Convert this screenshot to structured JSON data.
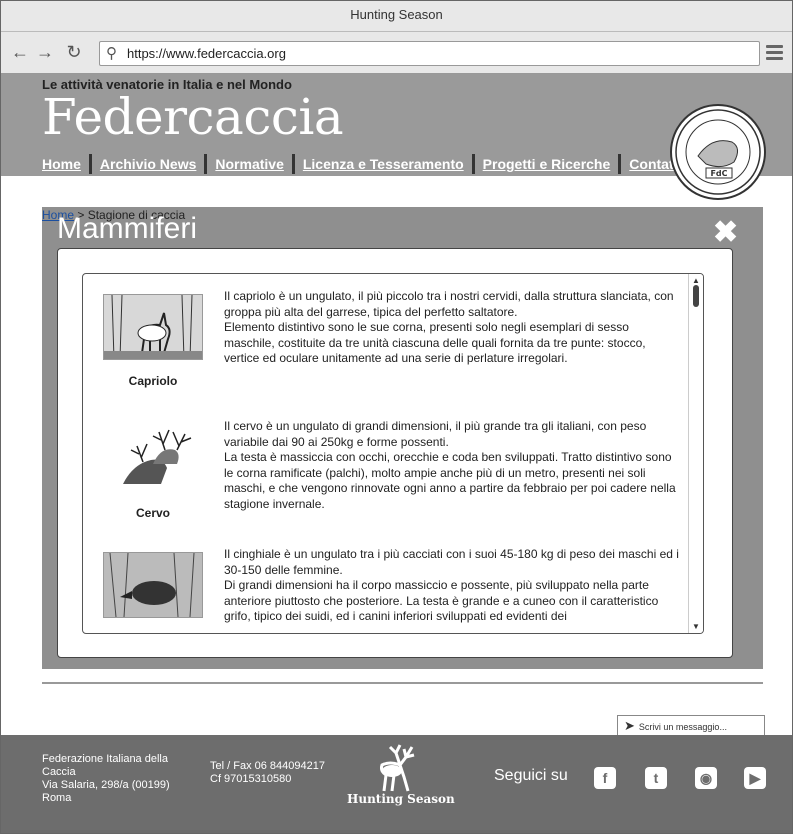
{
  "window": {
    "title": "Hunting Season"
  },
  "browser": {
    "url": "https://www.federcaccia.org"
  },
  "site": {
    "tagline": "Le attività venatorie in Italia e nel Mondo",
    "brand": "Federcaccia",
    "nav": [
      "Home",
      "Archivio News",
      "Normative",
      "Licenza e Tesseramento",
      "Progetti e Ricerche",
      "Contatti"
    ]
  },
  "breadcrumb": {
    "home": "Home",
    "sep": ">",
    "current": "Stagione di caccia"
  },
  "modal": {
    "title": "Mammiferi",
    "close": "✖",
    "entries": [
      {
        "name": "Capriolo",
        "text": "Il capriolo è un ungulato, il più piccolo tra i nostri cervidi, dalla struttura slanciata, con groppa più alta del garrese, tipica del perfetto saltatore.\nElemento distintivo sono le sue corna, presenti solo negli esemplari di sesso maschile, costituite da tre unità ciascuna delle quali fornita da tre punte: stocco, vertice ed oculare unitamente ad una serie di perlature irregolari."
      },
      {
        "name": "Cervo",
        "text": "Il cervo è un ungulato di grandi dimensioni, il più grande tra gli italiani, con peso variabile dai 90 ai 250kg e forme possenti.\nLa testa è massiccia con occhi, orecchie e coda ben sviluppati. Tratto distintivo sono le corna ramificate (palchi), molto ampie anche più di un metro, presenti nei soli maschi, e che vengono rinnovate ogni anno a partire da febbraio per poi cadere nella stagione invernale."
      },
      {
        "name": "",
        "text": "Il cinghiale è un ungulato tra i più cacciati con i suoi 45-180 kg di peso dei maschi ed i 30-150 delle femmine.\nDi grandi dimensioni ha il corpo massiccio e possente, più sviluppato nella parte anteriore piuttosto che posteriore. La testa è grande e a cuneo con il caratteristico grifo, tipico dei suidi, ed i canini inferiori sviluppati ed evidenti dei"
      }
    ]
  },
  "chat": {
    "placeholder": "Scrivi un messaggio..."
  },
  "footer": {
    "address": "Federazione Italiana della Caccia\nVia Salaria, 298/a (00199) Roma",
    "phone": "Tel / Fax 06 844094217",
    "cf": "Cf 97015310580",
    "brand": "Hunting Season",
    "follow": "Seguici su",
    "social": [
      "facebook-icon",
      "twitter-icon",
      "instagram-icon",
      "youtube-icon"
    ]
  }
}
